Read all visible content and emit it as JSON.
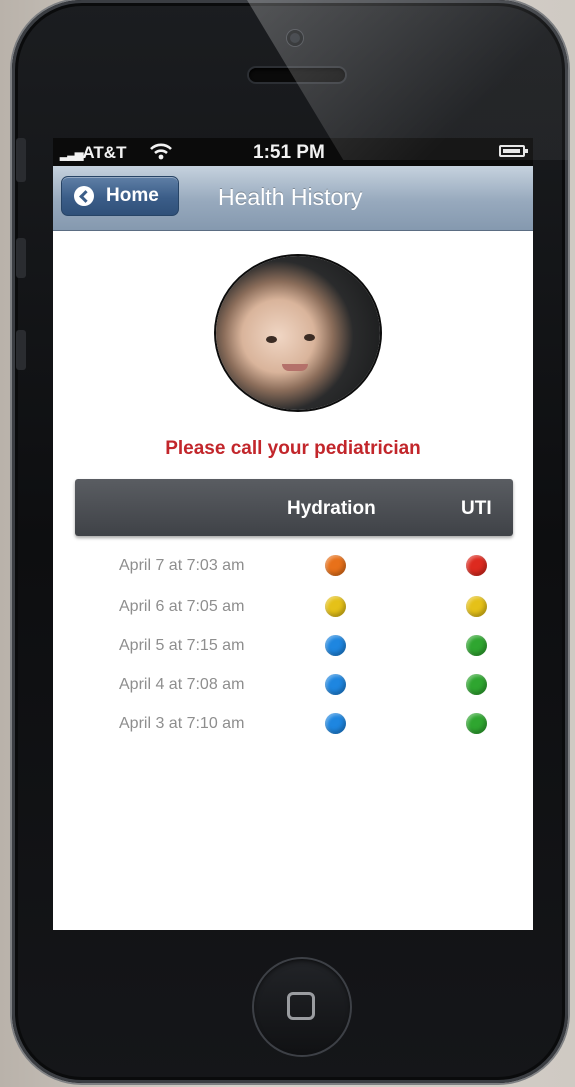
{
  "status_bar": {
    "carrier": "AT&T",
    "time": "1:51 PM"
  },
  "nav": {
    "back_label": "Home",
    "title": "Health History"
  },
  "alert_message": "Please call your pediatrician",
  "table": {
    "columns": [
      "Hydration",
      "UTI"
    ],
    "rows": [
      {
        "date": "April 7 at 7:03 am",
        "hydration_color": "#e8711a",
        "uti_color": "#dd2a1f"
      },
      {
        "date": "April 6 at 7:05 am",
        "hydration_color": "#e5c118",
        "uti_color": "#e5c118"
      },
      {
        "date": "April 5 at 7:15 am",
        "hydration_color": "#1e86e0",
        "uti_color": "#2fa630"
      },
      {
        "date": "April 4 at 7:08 am",
        "hydration_color": "#1e86e0",
        "uti_color": "#2fa630"
      },
      {
        "date": "April 3 at 7:10 am",
        "hydration_color": "#1e86e0",
        "uti_color": "#2fa630"
      }
    ]
  },
  "colors": {
    "alert": "#c2262b",
    "nav_button": "#3b5d88"
  }
}
